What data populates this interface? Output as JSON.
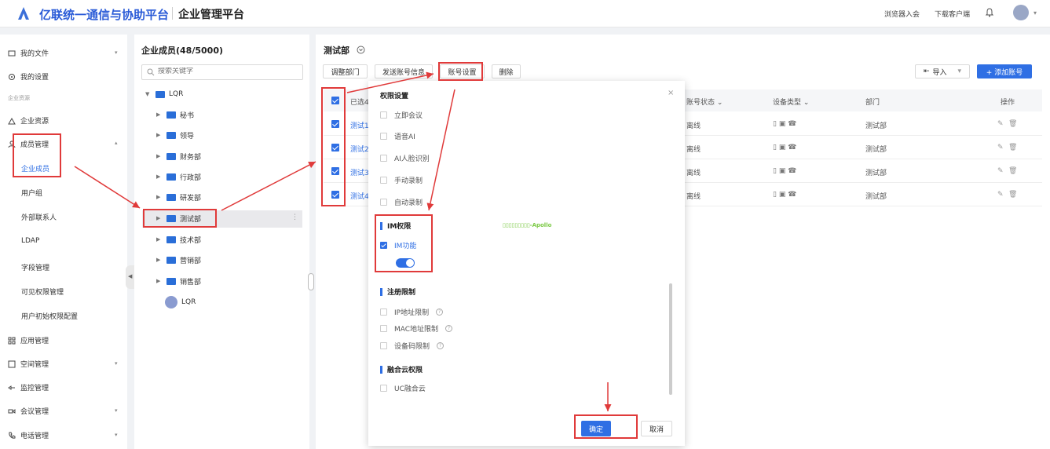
{
  "header": {
    "brand": "亿联统一通信与协助平台",
    "subtitle": "企业管理平台",
    "links": [
      "浏览器入会",
      "下载客户端"
    ]
  },
  "sidebar": {
    "items": [
      {
        "label": "我的文件",
        "icon": "file-icon"
      },
      {
        "label": "我的设置",
        "icon": "settings-icon"
      }
    ],
    "group_label": "企业资源",
    "resources": {
      "label": "企业资源",
      "icon": "building-icon"
    },
    "member_mgmt": {
      "label": "成员管理",
      "icon": "user-icon"
    },
    "member_sub": [
      "企业成员",
      "用户组",
      "外部联系人",
      "LDAP",
      "字段管理",
      "可见权限管理",
      "用户初始权限配置"
    ],
    "bottom_items": [
      {
        "label": "应用管理",
        "icon": "apps-icon"
      },
      {
        "label": "空间管理",
        "icon": "space-icon"
      },
      {
        "label": "监控管理",
        "icon": "monitor-icon"
      },
      {
        "label": "会议管理",
        "icon": "video-icon"
      },
      {
        "label": "电话管理",
        "icon": "phone-icon"
      }
    ]
  },
  "tree": {
    "title": "企业成员(48/5000)",
    "search_placeholder": "搜索关键字",
    "root": "LQR",
    "children": [
      "秘书",
      "领导",
      "财务部",
      "行政部",
      "研发部",
      "测试部",
      "技术部",
      "营销部",
      "销售部"
    ],
    "user": "LQR"
  },
  "main": {
    "title": "测试部",
    "toolbar": [
      "调整部门",
      "发送账号信息",
      "账号设置",
      "删除"
    ],
    "import_label": "导入",
    "add_label": "+ 添加账号",
    "columns": {
      "selected": "已选4",
      "status": "账号状态",
      "device": "设备类型",
      "dept": "部门",
      "ops": "操作"
    },
    "rows": [
      {
        "name": "测试1",
        "status": "离线",
        "dept": "测试部"
      },
      {
        "name": "测试2",
        "status": "离线",
        "dept": "测试部"
      },
      {
        "name": "测试3",
        "status": "离线",
        "dept": "测试部"
      },
      {
        "name": "测试4",
        "status": "离线",
        "dept": "测试部"
      }
    ]
  },
  "modal": {
    "title": "权限设置",
    "perms": [
      "立即会议",
      "语音AI",
      "AI人脸识别",
      "手动录制",
      "自动录制"
    ],
    "im_section": "IM权限",
    "im_feature": "IM功能",
    "reg_section": "注册限制",
    "reg_items": [
      "IP地址限制",
      "MAC地址限制",
      "设备码限制"
    ],
    "cloud_section": "融合云权限",
    "cloud_items": [
      "UC融合云"
    ],
    "confirm": "确定",
    "cancel": "取消"
  },
  "watermark": "▯▯▯▯▯▯▯▯▯-Apollo"
}
